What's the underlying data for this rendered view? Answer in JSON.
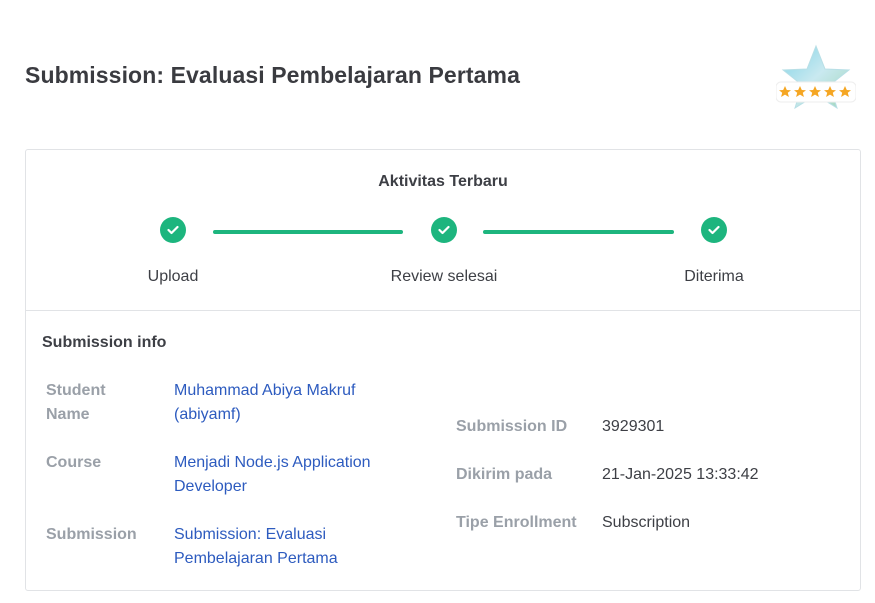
{
  "header": {
    "title": "Submission: Evaluasi Pembelajaran Pertama",
    "badge_icon": "five-star-rating-badge-icon"
  },
  "activity": {
    "title": "Aktivitas Terbaru",
    "steps": [
      {
        "label": "Upload",
        "status": "done"
      },
      {
        "label": "Review selesai",
        "status": "done"
      },
      {
        "label": "Diterima",
        "status": "done"
      }
    ],
    "accent_color": "#1db57e"
  },
  "info": {
    "title": "Submission info",
    "student_name_label": "Student Name",
    "student_name_value": "Muhammad Abiya Makruf (abiyamf)",
    "course_label": "Course",
    "course_value": "Menjadi Node.js Application Developer",
    "submission_label": "Submission",
    "submission_value": "Submission: Evaluasi Pembelajaran Pertama",
    "submission_id_label": "Submission ID",
    "submission_id_value": "3929301",
    "sent_label": "Dikirim pada",
    "sent_value": "21-Jan-2025 13:33:42",
    "enrollment_label": "Tipe Enrollment",
    "enrollment_value": "Subscription"
  }
}
